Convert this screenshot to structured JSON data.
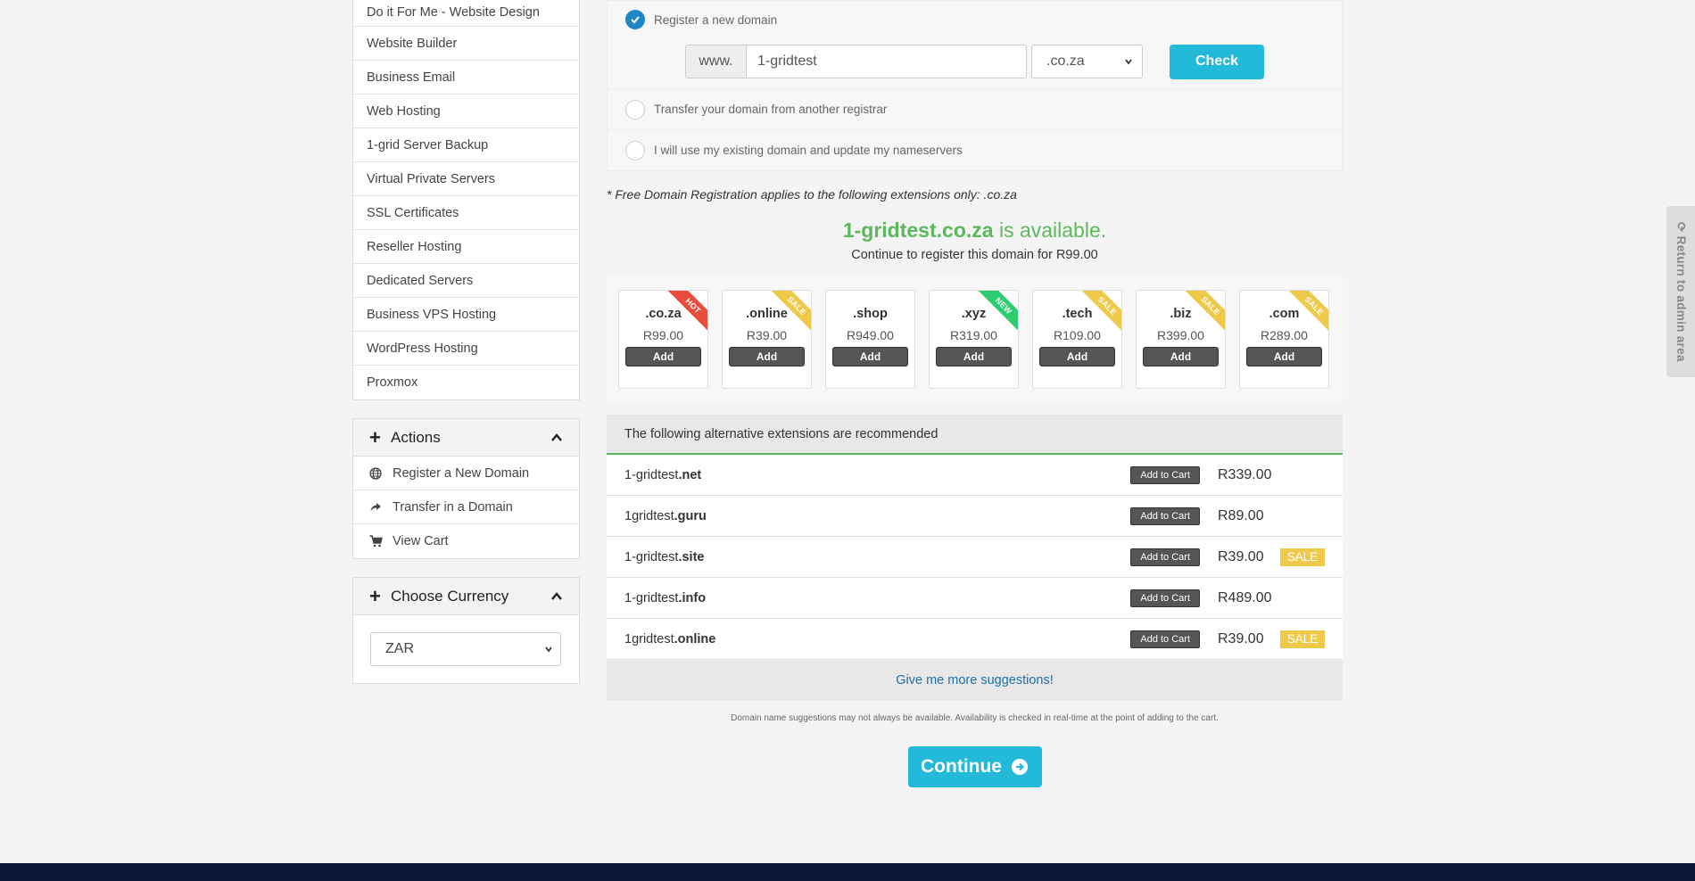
{
  "sidebar": {
    "categories": [
      "Do it For Me - Website Design",
      "Website Builder",
      "Business Email",
      "Web Hosting",
      "1-grid Server Backup",
      "Virtual Private Servers",
      "SSL Certificates",
      "Reseller Hosting",
      "Dedicated Servers",
      "Business VPS Hosting",
      "WordPress Hosting",
      "Proxmox"
    ],
    "actions": {
      "title": "Actions",
      "items": [
        {
          "label": "Register a New Domain",
          "icon": "globe-icon"
        },
        {
          "label": "Transfer in a Domain",
          "icon": "share-icon"
        },
        {
          "label": "View Cart",
          "icon": "cart-icon"
        }
      ]
    },
    "currency": {
      "title": "Choose Currency",
      "selected": "ZAR"
    }
  },
  "domain_options": {
    "register_label": "Register a new domain",
    "www_prefix": "www.",
    "domain_value": "1-gridtest",
    "tld_selected": ".co.za",
    "check_label": "Check",
    "transfer_label": "Transfer your domain from another registrar",
    "existing_label": "I will use my existing domain and update my nameservers"
  },
  "free_note": "* Free Domain Registration applies to the following extensions only: .co.za",
  "availability": {
    "domain": "1-gridtest.co.za",
    "status_text": "is available.",
    "subtext": "Continue to register this domain for R99.00"
  },
  "spotlight": [
    {
      "tld": ".co.za",
      "price": "R99.00",
      "badge": "HOT",
      "badge_color": "#e74c3c",
      "add": "Add"
    },
    {
      "tld": ".online",
      "price": "R39.00",
      "badge": "SALE",
      "badge_color": "#f0c94a",
      "add": "Add"
    },
    {
      "tld": ".shop",
      "price": "R949.00",
      "badge": "",
      "badge_color": "",
      "add": "Add"
    },
    {
      "tld": ".xyz",
      "price": "R319.00",
      "badge": "NEW",
      "badge_color": "#2ecc71",
      "add": "Add"
    },
    {
      "tld": ".tech",
      "price": "R109.00",
      "badge": "SALE",
      "badge_color": "#f0c94a",
      "add": "Add"
    },
    {
      "tld": ".biz",
      "price": "R399.00",
      "badge": "SALE",
      "badge_color": "#f0c94a",
      "add": "Add"
    },
    {
      "tld": ".com",
      "price": "R289.00",
      "badge": "SALE",
      "badge_color": "#f0c94a",
      "add": "Add"
    }
  ],
  "suggestions": {
    "header": "The following alternative extensions are recommended",
    "add_label": "Add to Cart",
    "rows": [
      {
        "base": "1-gridtest",
        "ext": ".net",
        "price": "R339.00",
        "sale": ""
      },
      {
        "base": "1gridtest",
        "ext": ".guru",
        "price": "R89.00",
        "sale": ""
      },
      {
        "base": "1-gridtest",
        "ext": ".site",
        "price": "R39.00",
        "sale": "SALE"
      },
      {
        "base": "1-gridtest",
        "ext": ".info",
        "price": "R489.00",
        "sale": ""
      },
      {
        "base": "1gridtest",
        "ext": ".online",
        "price": "R39.00",
        "sale": "SALE"
      }
    ],
    "more_label": "Give me more suggestions!",
    "disclaimer": "Domain name suggestions may not always be available. Availability is checked in real-time at the point of adding to the cart."
  },
  "continue_label": "Continue",
  "admin_tab_label": "Return to admin area",
  "colors": {
    "accent": "#23b9d9",
    "available": "#5cb85c",
    "checked_radio": "#1f87c8",
    "footer": "#0b1736"
  }
}
